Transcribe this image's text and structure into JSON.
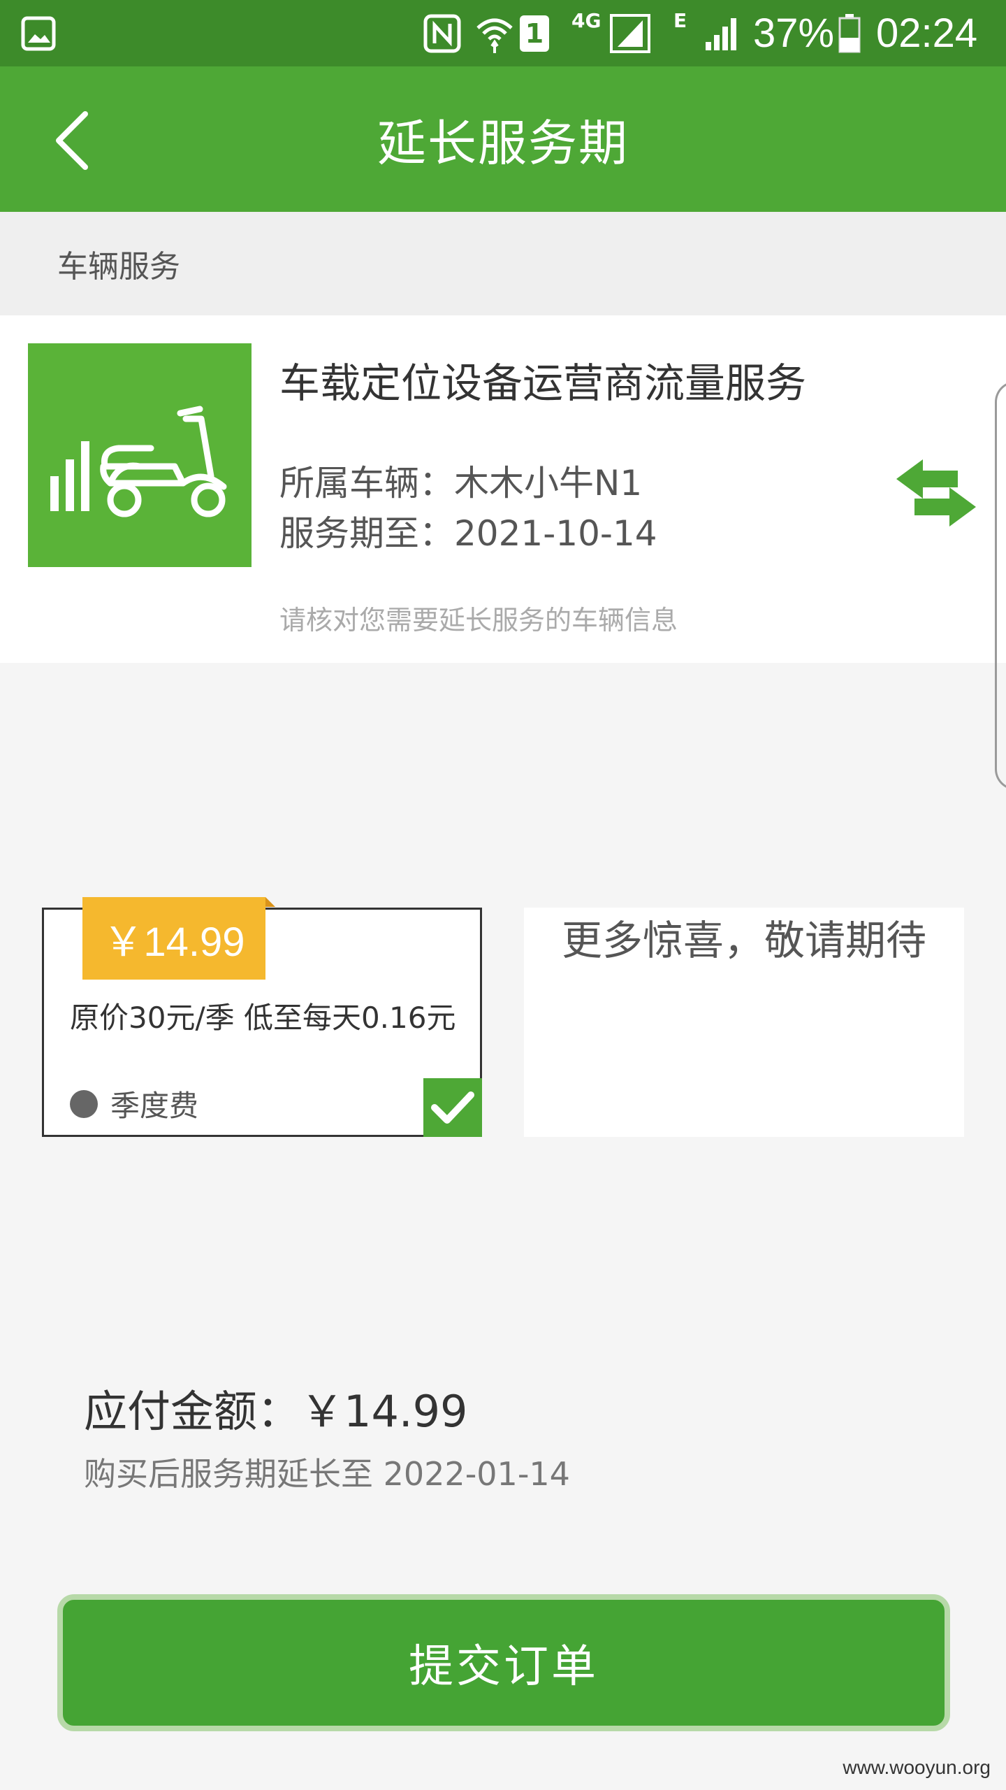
{
  "status_bar": {
    "battery": "37%",
    "time": "02:24",
    "network_label": "4G",
    "edge_label": "E",
    "sim_label": "1"
  },
  "header": {
    "title": "延长服务期"
  },
  "section": {
    "title": "车辆服务"
  },
  "service": {
    "name": "车载定位设备运营商流量服务",
    "vehicle": "所属车辆：木木小牛N1",
    "expiry": "服务期至：2021-10-14",
    "hint": "请核对您需要延长服务的车辆信息"
  },
  "plan": {
    "price": "￥14.99",
    "description": "原价30元/季 低至每天0.16元",
    "type": "季度费",
    "selected": true
  },
  "more": {
    "text": "更多惊喜，敬请期待"
  },
  "summary": {
    "total": "应付金额：￥14.99",
    "extend": "购买后服务期延长至 2022-01-14"
  },
  "actions": {
    "submit": "提交订单"
  },
  "watermark": "www.wooyun.org",
  "colors": {
    "status_bar": "#3d8b2a",
    "header": "#4ea836",
    "accent": "#5ab338",
    "price_tag": "#f5b82e"
  }
}
